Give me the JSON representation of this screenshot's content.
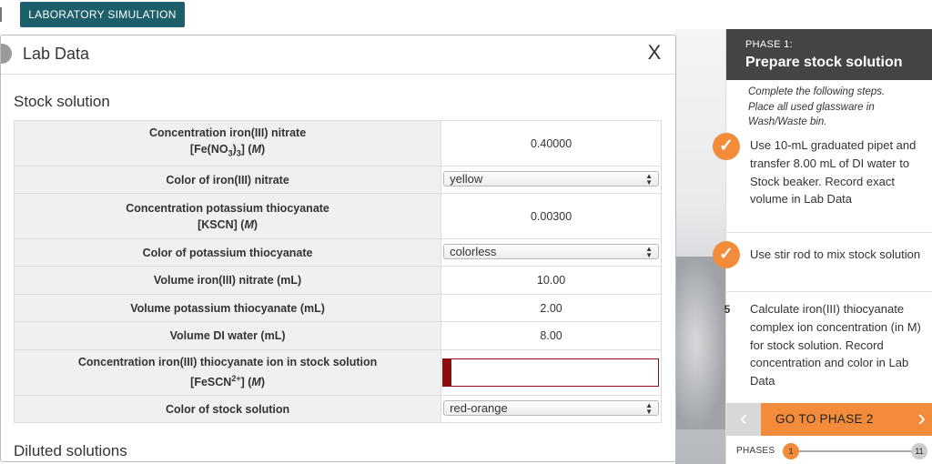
{
  "topbar": {
    "lab_button": "LABORATORY SIMULATION"
  },
  "modal": {
    "title": "Lab Data",
    "close": "X",
    "section_stock": "Stock solution",
    "section_diluted": "Diluted solutions",
    "rows": [
      {
        "label_line1": "Concentration iron(III) nitrate",
        "label_line2": "[Fe(NO3)3] (M)",
        "value": "0.40000",
        "kind": "text"
      },
      {
        "label_line1": "Color of iron(III) nitrate",
        "value": "yellow",
        "kind": "select"
      },
      {
        "label_line1": "Concentration potassium thiocyanate",
        "label_line2": "[KSCN] (M)",
        "value": "0.00300",
        "kind": "text"
      },
      {
        "label_line1": "Color of potassium thiocyanate",
        "value": "colorless",
        "kind": "select"
      },
      {
        "label_line1": "Volume iron(III) nitrate (mL)",
        "value": "10.00",
        "kind": "text"
      },
      {
        "label_line1": "Volume potassium thiocyanate (mL)",
        "value": "2.00",
        "kind": "text"
      },
      {
        "label_line1": "Volume DI water (mL)",
        "value": "8.00",
        "kind": "text"
      },
      {
        "label_line1": "Concentration iron(III) thiocyanate ion in stock solution",
        "label_line2": "[FeSCN2+] (M)",
        "value": "",
        "kind": "input"
      },
      {
        "label_line1": "Color of stock solution",
        "value": "red-orange",
        "kind": "select"
      }
    ]
  },
  "panel": {
    "phase_label": "PHASE 1:",
    "phase_name": "Prepare stock solution",
    "instructions": "Complete the following steps. Place all used glassware in Wash/Waste bin.",
    "steps": [
      {
        "status": "done",
        "text": "Use 10-mL graduated pipet and transfer 8.00 mL of DI water to Stock beaker. Record exact volume in Lab Data"
      },
      {
        "status": "done",
        "text": "Use stir rod to mix stock solution"
      },
      {
        "status": "current",
        "number": "5",
        "text": "Calculate iron(III) thiocyanate complex ion concentration (in M) for stock solution. Record concentration and color in Lab Data"
      }
    ],
    "go_button": "GO TO PHASE 2",
    "phases_label": "PHASES",
    "phase_start": "1",
    "phase_end": "11"
  },
  "colors": {
    "teal": "#1c5f6a",
    "orange": "#f28c3b",
    "error": "#8b0e0e",
    "panel_head": "#444444"
  },
  "icons": {
    "check": "check-icon",
    "back": "chevron-left-icon",
    "forward": "chevron-right-icon",
    "select": "select-arrows-icon"
  }
}
